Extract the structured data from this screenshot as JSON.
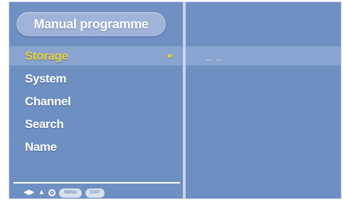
{
  "header": {
    "title": "Manual programme"
  },
  "menu": {
    "items": [
      {
        "label": "Storage",
        "selected": true
      },
      {
        "label": "System"
      },
      {
        "label": "Channel"
      },
      {
        "label": "Search"
      },
      {
        "label": "Name"
      }
    ]
  },
  "detail": {
    "storage_value": "_ _"
  },
  "footer": {
    "icons": [
      "left-right-arrows-icon",
      "up-down-arrows-icon",
      "ok-icon",
      "menu-button-icon",
      "exit-button-icon"
    ],
    "menu_label": "MENU",
    "exit_label": "EXIT"
  },
  "colors": {
    "background": "#6e8fc2",
    "highlight_band": "#8aa4d0",
    "selected_text": "#e8d23c",
    "text": "#ffffff"
  }
}
